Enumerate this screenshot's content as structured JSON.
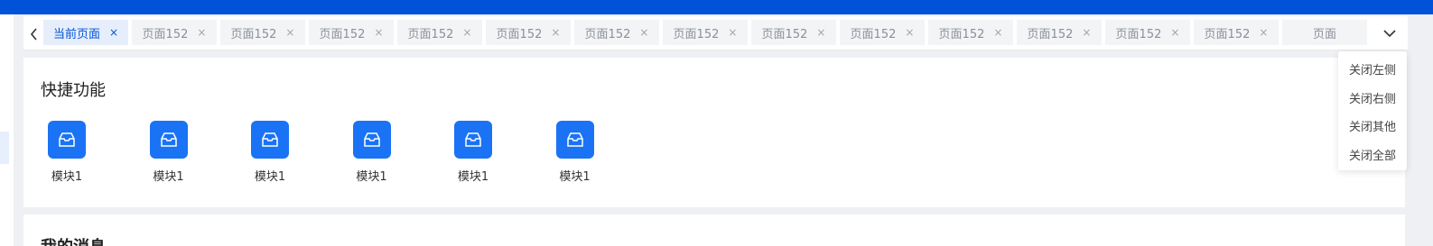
{
  "tabs": {
    "active_label": "当前页面",
    "items": [
      "页面152",
      "页面152",
      "页面152",
      "页面152",
      "页面152",
      "页面152",
      "页面152",
      "页面152",
      "页面152",
      "页面152",
      "页面152",
      "页面152",
      "页面152"
    ],
    "partial_label": "页面",
    "close_glyph": "×",
    "scroll_left_icon": "chevron-left-icon",
    "more_icon": "chevron-down-icon"
  },
  "dropdown": {
    "items": [
      "关闭左侧",
      "关闭右侧",
      "关闭其他",
      "关闭全部"
    ]
  },
  "quick": {
    "title": "快捷功能",
    "modules": [
      "模块1",
      "模块1",
      "模块1",
      "模块1",
      "模块1",
      "模块1"
    ],
    "module_icon": "mailbox-icon"
  },
  "messages": {
    "title": "我的消息"
  },
  "colors": {
    "brand": "#0052d9",
    "module_tile": "#1a73f5",
    "active_tab_bg": "#e6eefc"
  }
}
